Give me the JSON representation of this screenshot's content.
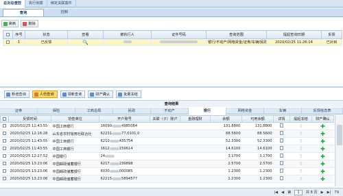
{
  "top_tabs": [
    "总对总查控",
    "执行划拨",
    "绑定关联案件"
  ],
  "sub_tabs": [
    "查询",
    "控制"
  ],
  "toolbar": {
    "refresh": "刷新",
    "delete": "删除"
  },
  "query_table": {
    "headers": [
      "",
      "序号",
      "状态",
      "查看",
      "被执行人",
      "证件号码",
      "查询范围",
      "提起查询日期",
      "反馈"
    ],
    "row": {
      "seq": "1",
      "status": "已反馈",
      "scope": "银行/不动产/网络资金/证券/车辆/民政",
      "date": "2020/02/25 11:26:14",
      "feedback": "已对目"
    }
  },
  "actions": [
    "新增查询",
    "人伤查询",
    "领新查询",
    "财产确认",
    "批量冻结"
  ],
  "result_title": "查询结果",
  "categories": [
    "证券",
    "保险",
    "工商总局",
    "民政",
    "不动产",
    "银行",
    "网络资金",
    "车辆",
    "反馈信息表"
  ],
  "active_category": "银行",
  "result_headers": [
    "",
    "反馈时间",
    "协查单位",
    "开户账号",
    "关联（子）账户",
    "金融理财",
    "余额",
    "可用余额",
    "详情",
    "提起冻结",
    "财产确认"
  ],
  "result_rows": [
    {
      "time": "2020/02/25 11:43:55",
      "bank": "中国工商银行",
      "acct_a": "16090",
      "acct_b": "4985084",
      "balance": "131.8800",
      "available": "131.8800"
    },
    {
      "time": "2020/02/25 12:16:28",
      "bank": "山东省农村信用社联合社",
      "acct_a": "62231",
      "acct_b": "77,0101,0",
      "balance": "88.5600",
      "available": "88.5600"
    },
    {
      "time": "2020/02/25 11:43:55",
      "bank": "中国工商银行",
      "acct_a": "6210",
      "acct_b": "435754",
      "balance": "52.3300",
      "available": "52.3300"
    },
    {
      "time": "2020/02/25 11:43:55",
      "bank": "中国工商银行",
      "acct_a": "1612",
      "acct_b": "159614",
      "balance": "14.6100",
      "available": "14.6100"
    },
    {
      "time": "2020/02/25 12:27:52",
      "bank": "中国银行",
      "acct_a": "24",
      "acct_b": "",
      "balance": "3.1700",
      "available": "3.1700"
    },
    {
      "time": "2020/02/25 13:23:06",
      "bank": "中国邮政储蓄银行",
      "acct_a": "6217",
      "acct_b": "239898",
      "balance": "2.5700",
      "available": "2.5700"
    },
    {
      "time": "2020/02/25 13:23:06",
      "bank": "中国邮政储蓄银行",
      "acct_a": "6030",
      "acct_b": "000085",
      "balance": "1.2300",
      "available": "1.2300"
    },
    {
      "time": "2020/02/25 13:23:06",
      "bank": "中国邮政储蓄银行",
      "acct_a": "62215",
      "acct_b": "5894577",
      "balance": "1.2300",
      "available": "1.2300"
    }
  ],
  "pager": {
    "page_label": "第",
    "page": "1",
    "total": "共 8 页",
    "per_page": "79"
  },
  "colors": {
    "accent": "#8fb0d0",
    "highlight": "#ffd86b",
    "plus": "#23a23a"
  }
}
